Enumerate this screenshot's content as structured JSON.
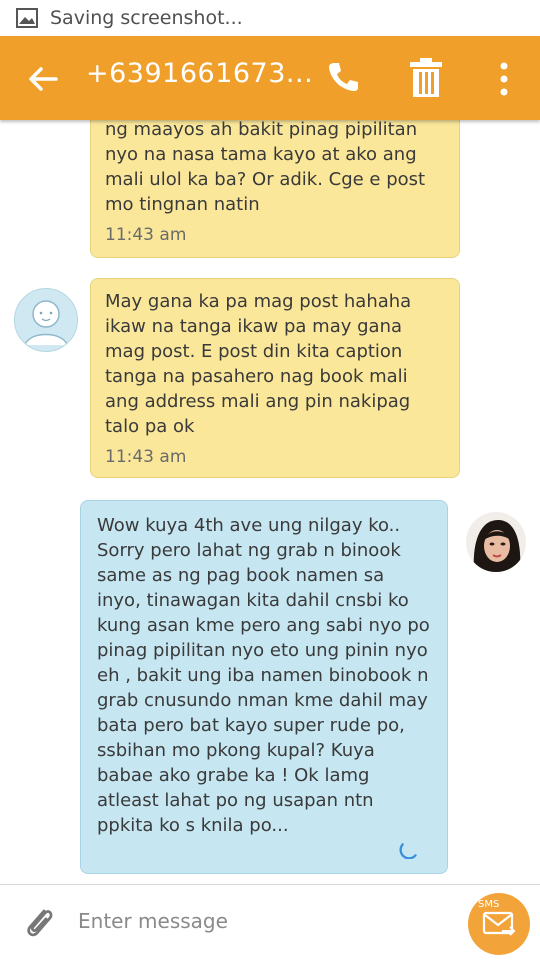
{
  "status_bar": {
    "text": "Saving screenshot..."
  },
  "toolbar": {
    "title": "+6391661673..."
  },
  "messages": [
    {
      "direction": "in",
      "text": "ng maayos ah bakit pinag pipilitan nyo na nasa tama kayo at ako ang mali ulol ka ba? Or adik. Cge e post mo tingnan natin",
      "time": "11:43 am"
    },
    {
      "direction": "in",
      "text": "May gana ka pa mag post hahaha ikaw na tanga ikaw pa may gana mag post. E post din kita caption tanga na pasahero nag book mali ang address mali ang pin nakipag talo pa ok",
      "time": "11:43 am"
    },
    {
      "direction": "out",
      "text": "Wow kuya 4th ave ung nilgay ko.. Sorry pero lahat ng grab n binook same as ng pag book namen sa inyo, tinawagan kita dahil cnsbi ko kung asan kme pero ang sabi nyo po pinag pipilitan nyo eto ung pinin nyo eh , bakit ung iba namen binobook n grab cnusundo nman kme dahil may bata pero bat kayo super rude po, ssbihan mo pkong kupal? Kuya babae ako grabe ka ! Ok lamg atleast lahat po ng usapan ntn ppkita ko s knila po...",
      "time": ""
    }
  ],
  "composer": {
    "placeholder": "Enter message",
    "send_badge": "SMS"
  },
  "colors": {
    "toolbar": "#f0a02a",
    "incoming_bubble": "#fbe79a",
    "outgoing_bubble": "#c6e6f2",
    "send_button": "#f2a43a"
  }
}
